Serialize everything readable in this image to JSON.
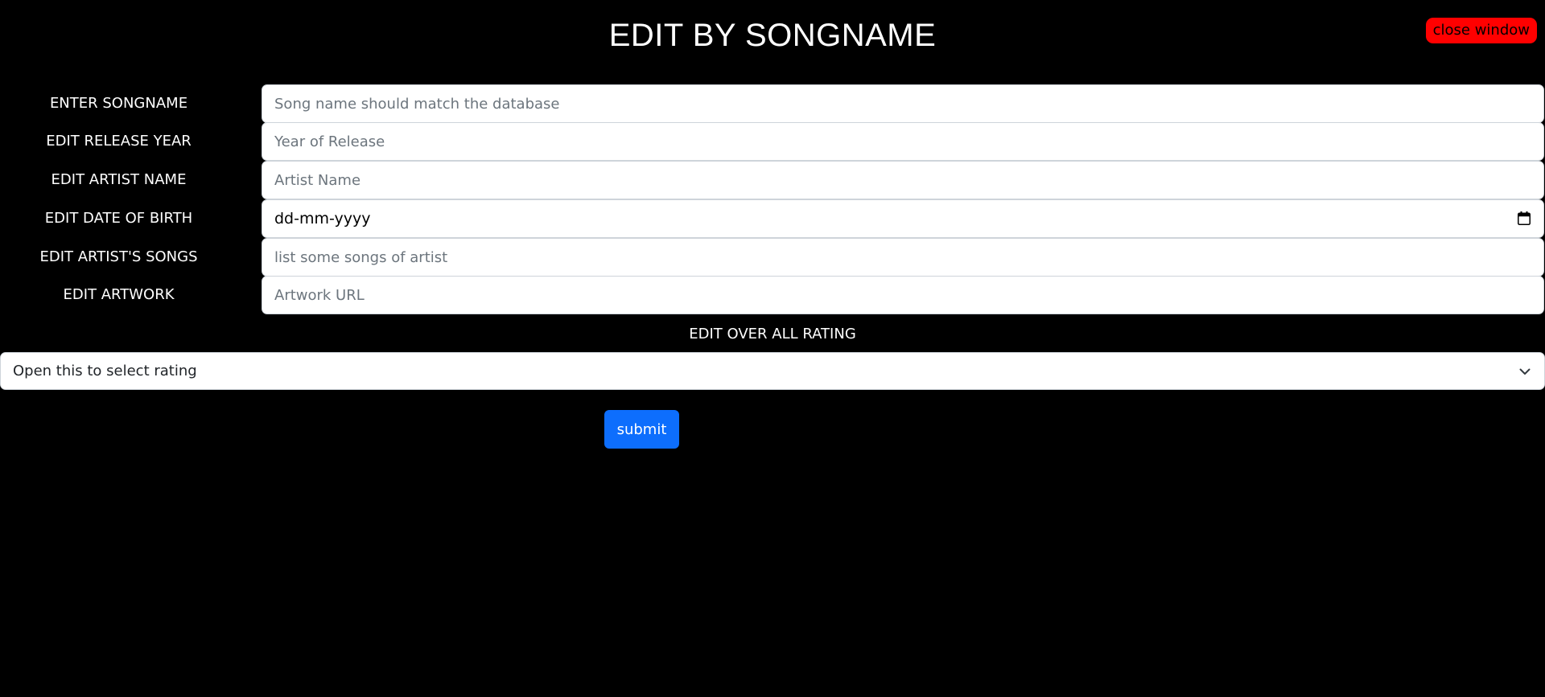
{
  "header": {
    "title": "EDIT BY SONGNAME",
    "close_label": "close window"
  },
  "form": {
    "fields": [
      {
        "label": "ENTER SONGNAME",
        "placeholder": "Song name should match the database",
        "value": ""
      },
      {
        "label": "EDIT RELEASE YEAR",
        "placeholder": "Year of Release",
        "value": ""
      },
      {
        "label": "EDIT ARTIST NAME",
        "placeholder": "Artist Name",
        "value": ""
      },
      {
        "label": "EDIT DATE OF BIRTH",
        "display": "dd-mm-yyyy"
      },
      {
        "label": "EDIT ARTIST'S SONGS",
        "placeholder": "list some songs of artist",
        "value": ""
      },
      {
        "label": "EDIT ARTWORK",
        "placeholder": "Artwork URL",
        "value": ""
      }
    ],
    "rating": {
      "label": "EDIT OVER ALL RATING",
      "selected": "Open this to select rating"
    },
    "submit_label": "submit"
  },
  "colors": {
    "background": "#000000",
    "close_button": "#ff0000",
    "submit_button": "#0d6efd"
  }
}
